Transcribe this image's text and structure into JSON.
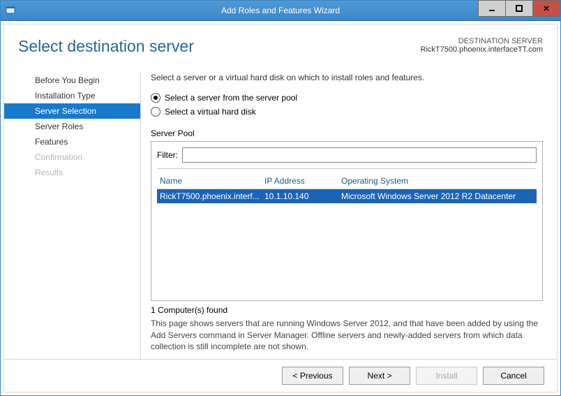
{
  "window": {
    "title": "Add Roles and Features Wizard"
  },
  "header": {
    "pageTitle": "Select destination server",
    "destLabel": "DESTINATION SERVER",
    "destHost": "RickT7500.phoenix.interfaceTT.com"
  },
  "sidebar": {
    "items": [
      {
        "label": "Before You Begin",
        "selected": false,
        "disabled": false
      },
      {
        "label": "Installation Type",
        "selected": false,
        "disabled": false
      },
      {
        "label": "Server Selection",
        "selected": true,
        "disabled": false
      },
      {
        "label": "Server Roles",
        "selected": false,
        "disabled": false
      },
      {
        "label": "Features",
        "selected": false,
        "disabled": false
      },
      {
        "label": "Confirmation",
        "selected": false,
        "disabled": true
      },
      {
        "label": "Results",
        "selected": false,
        "disabled": true
      }
    ]
  },
  "main": {
    "instruction": "Select a server or a virtual hard disk on which to install roles and features.",
    "radios": {
      "pool": "Select a server from the server pool",
      "vhd": "Select a virtual hard disk",
      "selected": "pool"
    },
    "poolLabel": "Server Pool",
    "filterLabel": "Filter:",
    "filterValue": "",
    "columns": {
      "name": "Name",
      "ip": "IP Address",
      "os": "Operating System"
    },
    "rows": [
      {
        "name": "RickT7500.phoenix.interf...",
        "ip": "10.1.10.140",
        "os": "Microsoft Windows Server 2012 R2 Datacenter"
      }
    ],
    "countText": "1 Computer(s) found",
    "footnote": "This page shows servers that are running Windows Server 2012, and that have been added by using the Add Servers command in Server Manager. Offline servers and newly-added servers from which data collection is still incomplete are not shown."
  },
  "buttons": {
    "previous": "< Previous",
    "next": "Next >",
    "install": "Install",
    "cancel": "Cancel"
  }
}
